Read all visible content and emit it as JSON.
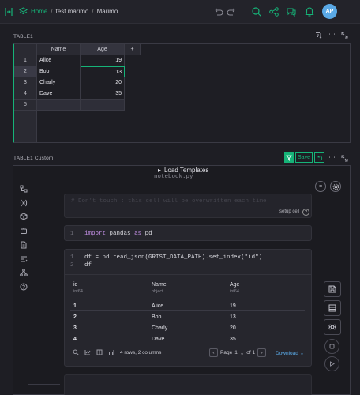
{
  "topbar": {
    "breadcrumb": [
      "Home",
      "test marimo",
      "Marimo"
    ],
    "separator": "/",
    "avatar_initials": "AP"
  },
  "table1": {
    "title": "TABLE1",
    "columns": [
      "Name",
      "Age",
      "+"
    ],
    "rows": [
      {
        "num": "1",
        "name": "Alice",
        "age": "19"
      },
      {
        "num": "2",
        "name": "Bob",
        "age": "13"
      },
      {
        "num": "3",
        "name": "Charly",
        "age": "20"
      },
      {
        "num": "4",
        "name": "Dave",
        "age": "35"
      },
      {
        "num": "5",
        "name": "",
        "age": ""
      }
    ]
  },
  "custom": {
    "title": "TABLE1 Custom",
    "save_label": "Save",
    "load_templates": "Load Templates",
    "notebook_file": "notebook.py",
    "cell0_code": "# Don't touch : this cell will be overwritten each time",
    "setup_cell_label": "setup cell",
    "cell1": {
      "line": "1",
      "code_kw": "import",
      "code_mid": " pandas ",
      "code_kw2": "as",
      "code_end": " pd"
    },
    "cell2": {
      "line1": "1",
      "line2": "2",
      "code1": "df = pd.read_json(GRIST_DATA_PATH).set_index(\"id\")",
      "code2": "df"
    },
    "dataframe": {
      "columns": [
        {
          "name": "id",
          "dtype": "int64"
        },
        {
          "name": "Name",
          "dtype": "object"
        },
        {
          "name": "Age",
          "dtype": "int64"
        }
      ],
      "rows": [
        [
          "1",
          "Alice",
          "19"
        ],
        [
          "2",
          "Bob",
          "13"
        ],
        [
          "3",
          "Charly",
          "20"
        ],
        [
          "4",
          "Dave",
          "35"
        ]
      ],
      "summary": "4 rows, 2 columns",
      "page_label": "Page",
      "page_value": "1",
      "of_label": "of 1",
      "download_label": "Download"
    }
  },
  "colors": {
    "accent": "#16b378",
    "background": "#1e1e24"
  }
}
